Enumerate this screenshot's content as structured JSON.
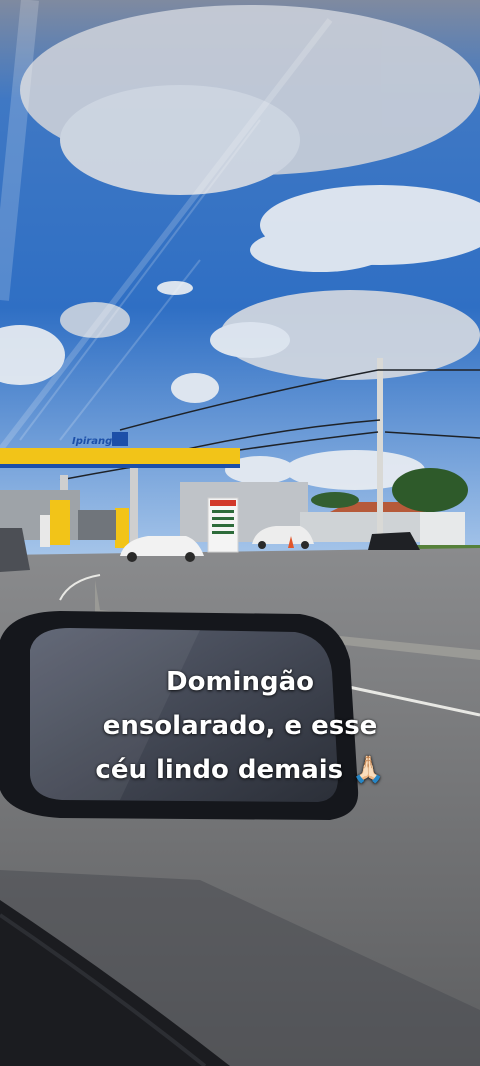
{
  "caption": {
    "line1": "Domingão",
    "line2": "ensolarado, e esse",
    "line3": "céu lindo demais 🙏🏻"
  },
  "scene": {
    "station_brand": "Ipiranga",
    "colors": {
      "sky_top": "#2f6fc4",
      "sky_bottom": "#8fb8e6",
      "canopy_yellow": "#f2c418",
      "road": "#6f7072",
      "dirt": "#b8573a"
    }
  }
}
